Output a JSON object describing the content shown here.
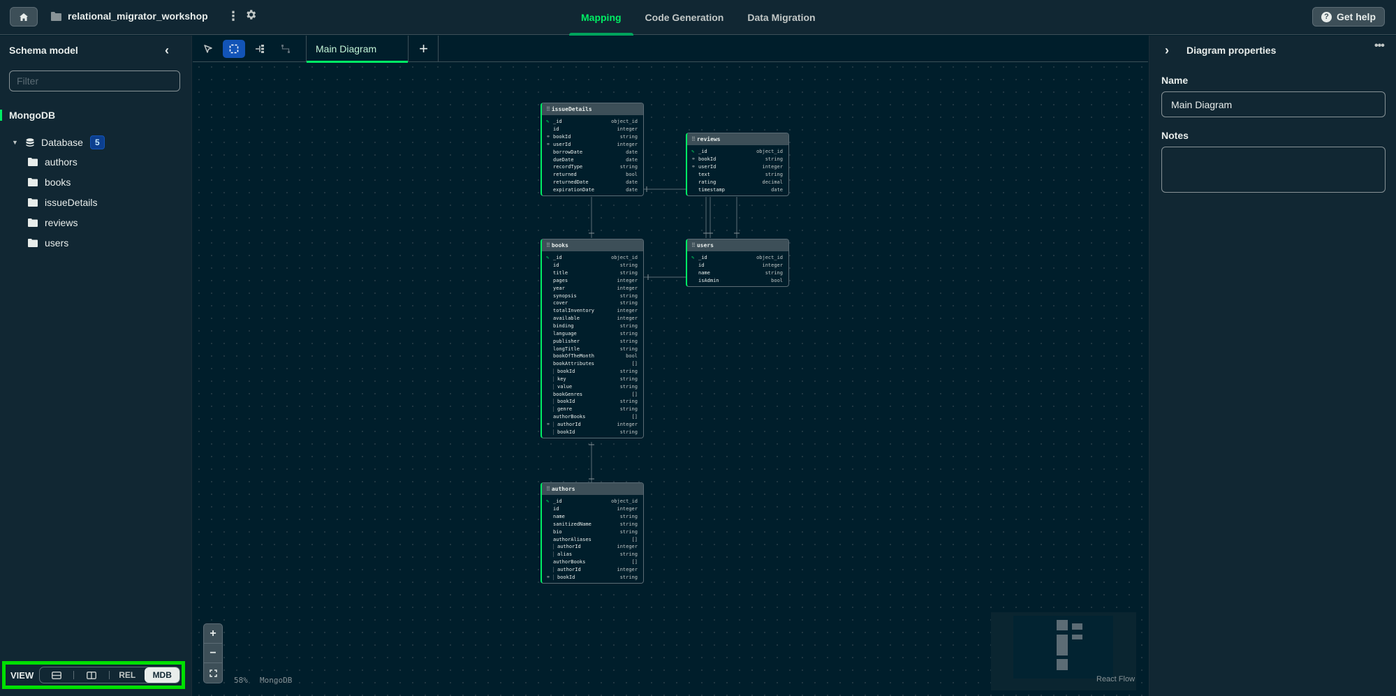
{
  "header": {
    "project_name": "relational_migrator_workshop",
    "tabs": [
      {
        "label": "Mapping",
        "active": true
      },
      {
        "label": "Code Generation",
        "active": false
      },
      {
        "label": "Data Migration",
        "active": false
      }
    ],
    "help_label": "Get help",
    "help_icon": "?"
  },
  "sidebar": {
    "title": "Schema model",
    "collapse_icon": "‹",
    "filter_placeholder": "Filter",
    "section_label": "MongoDB",
    "database": {
      "label": "Database",
      "count": "5"
    },
    "collections": [
      "authors",
      "books",
      "issueDetails",
      "reviews",
      "users"
    ],
    "view": {
      "label": "VIEW",
      "options": [
        "REL",
        "MDB"
      ],
      "selected": "MDB"
    }
  },
  "canvas": {
    "diagram_tab": "Main Diagram",
    "add_tab_icon": "+",
    "zoom_in": "+",
    "zoom_out": "−",
    "zoom_level": "58%",
    "db_label": "MongoDB",
    "attribution": "React Flow",
    "nodes": {
      "issueDetails": {
        "title": "issueDetails",
        "fields": [
          {
            "icon": "pk",
            "name": "_id",
            "type": "object_id"
          },
          {
            "icon": "",
            "name": "id",
            "type": "integer"
          },
          {
            "icon": "fk",
            "name": "bookId",
            "type": "string"
          },
          {
            "icon": "fk",
            "name": "userId",
            "type": "integer"
          },
          {
            "icon": "",
            "name": "borrowDate",
            "type": "date"
          },
          {
            "icon": "",
            "name": "dueDate",
            "type": "date"
          },
          {
            "icon": "",
            "name": "recordType",
            "type": "string"
          },
          {
            "icon": "",
            "name": "returned",
            "type": "bool"
          },
          {
            "icon": "",
            "name": "returnedDate",
            "type": "date"
          },
          {
            "icon": "",
            "name": "expirationDate",
            "type": "date"
          }
        ]
      },
      "reviews": {
        "title": "reviews",
        "fields": [
          {
            "icon": "pk",
            "name": "_id",
            "type": "object_id"
          },
          {
            "icon": "fk",
            "name": "bookId",
            "type": "string"
          },
          {
            "icon": "fk",
            "name": "userId",
            "type": "integer"
          },
          {
            "icon": "",
            "name": "text",
            "type": "string"
          },
          {
            "icon": "",
            "name": "rating",
            "type": "decimal"
          },
          {
            "icon": "",
            "name": "timestamp",
            "type": "date"
          }
        ]
      },
      "books": {
        "title": "books",
        "fields": [
          {
            "icon": "pk",
            "name": "_id",
            "type": "object_id"
          },
          {
            "icon": "",
            "name": "id",
            "type": "string"
          },
          {
            "icon": "",
            "name": "title",
            "type": "string"
          },
          {
            "icon": "",
            "name": "pages",
            "type": "integer"
          },
          {
            "icon": "",
            "name": "year",
            "type": "integer"
          },
          {
            "icon": "",
            "name": "synopsis",
            "type": "string"
          },
          {
            "icon": "",
            "name": "cover",
            "type": "string"
          },
          {
            "icon": "",
            "name": "totalInventory",
            "type": "integer"
          },
          {
            "icon": "",
            "name": "available",
            "type": "integer"
          },
          {
            "icon": "",
            "name": "binding",
            "type": "string"
          },
          {
            "icon": "",
            "name": "language",
            "type": "string"
          },
          {
            "icon": "",
            "name": "publisher",
            "type": "string"
          },
          {
            "icon": "",
            "name": "longTitle",
            "type": "string"
          },
          {
            "icon": "",
            "name": "bookOfTheMonth",
            "type": "bool"
          },
          {
            "icon": "",
            "name": "bookAttributes",
            "type": "[]"
          },
          {
            "icon": "",
            "name": "bookId",
            "type": "string",
            "nested": true
          },
          {
            "icon": "",
            "name": "key",
            "type": "string",
            "nested": true
          },
          {
            "icon": "",
            "name": "value",
            "type": "string",
            "nested": true
          },
          {
            "icon": "",
            "name": "bookGenres",
            "type": "[]"
          },
          {
            "icon": "",
            "name": "bookId",
            "type": "string",
            "nested": true
          },
          {
            "icon": "",
            "name": "genre",
            "type": "string",
            "nested": true
          },
          {
            "icon": "",
            "name": "authorBooks",
            "type": "[]"
          },
          {
            "icon": "fk",
            "name": "authorId",
            "type": "integer",
            "nested": true
          },
          {
            "icon": "",
            "name": "bookId",
            "type": "string",
            "nested": true
          }
        ]
      },
      "users": {
        "title": "users",
        "fields": [
          {
            "icon": "pk",
            "name": "_id",
            "type": "object_id"
          },
          {
            "icon": "",
            "name": "id",
            "type": "integer"
          },
          {
            "icon": "",
            "name": "name",
            "type": "string"
          },
          {
            "icon": "",
            "name": "isAdmin",
            "type": "bool"
          }
        ]
      },
      "authors": {
        "title": "authors",
        "fields": [
          {
            "icon": "pk",
            "name": "_id",
            "type": "object_id"
          },
          {
            "icon": "",
            "name": "id",
            "type": "integer"
          },
          {
            "icon": "",
            "name": "name",
            "type": "string"
          },
          {
            "icon": "",
            "name": "sanitizedName",
            "type": "string"
          },
          {
            "icon": "",
            "name": "bio",
            "type": "string"
          },
          {
            "icon": "",
            "name": "authorAliases",
            "type": "[]"
          },
          {
            "icon": "",
            "name": "authorId",
            "type": "integer",
            "nested": true
          },
          {
            "icon": "",
            "name": "alias",
            "type": "string",
            "nested": true
          },
          {
            "icon": "",
            "name": "authorBooks",
            "type": "[]"
          },
          {
            "icon": "",
            "name": "authorId",
            "type": "integer",
            "nested": true
          },
          {
            "icon": "fk",
            "name": "bookId",
            "type": "string",
            "nested": true
          }
        ]
      }
    }
  },
  "properties": {
    "title": "Diagram properties",
    "name_label": "Name",
    "name_value": "Main Diagram",
    "notes_label": "Notes",
    "notes_value": ""
  },
  "colors": {
    "accent": "#00ed64",
    "active_tool": "#1254b7",
    "badge": "#0c3f8f",
    "highlight_box": "#00e000"
  }
}
